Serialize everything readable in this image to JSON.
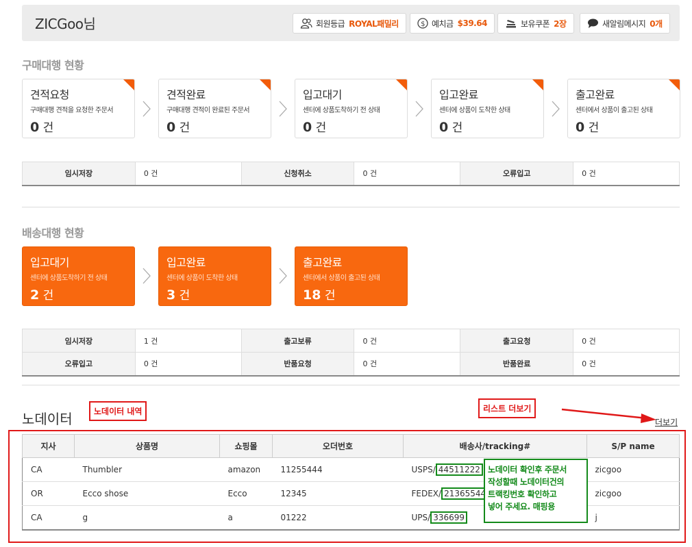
{
  "header": {
    "username": "ZICGoo님",
    "grade_label": "회원등급",
    "grade_value": "ROYAL패밀리",
    "deposit_label": "예치금",
    "deposit_value": "$39.64",
    "coupon_label": "보유쿠폰",
    "coupon_value": "2장",
    "message_label": "새알림메시지",
    "message_value": "0개"
  },
  "purchase": {
    "title": "구매대행 현황",
    "cards": [
      {
        "title": "견적요청",
        "desc": "구매대행 견적을 요청한 주문서",
        "count": "0",
        "unit": "건"
      },
      {
        "title": "견적완료",
        "desc": "구매대행 견적이 완료된 주문서",
        "count": "0",
        "unit": "건"
      },
      {
        "title": "입고대기",
        "desc": "센터에 상품도착하기 전 상태",
        "count": "0",
        "unit": "건"
      },
      {
        "title": "입고완료",
        "desc": "센터에 상품이 도착한 상태",
        "count": "0",
        "unit": "건"
      },
      {
        "title": "출고완료",
        "desc": "센터에서 상품이 출고된 상태",
        "count": "0",
        "unit": "건"
      }
    ],
    "stats": [
      {
        "label": "임시저장",
        "value": "0 건"
      },
      {
        "label": "신청취소",
        "value": "0 건"
      },
      {
        "label": "오류입고",
        "value": "0 건"
      }
    ]
  },
  "shipping": {
    "title": "배송대행 현황",
    "cards": [
      {
        "title": "입고대기",
        "desc": "센터에 상품도착하기 전 상태",
        "count": "2",
        "unit": "건"
      },
      {
        "title": "입고완료",
        "desc": "센터에 상품이 도착한 상태",
        "count": "3",
        "unit": "건"
      },
      {
        "title": "출고완료",
        "desc": "센터에서 상품이 출고된 상태",
        "count": "18",
        "unit": "건"
      }
    ],
    "stats": [
      {
        "label": "임시저장",
        "value": "1 건"
      },
      {
        "label": "출고보류",
        "value": "0 건"
      },
      {
        "label": "출고요청",
        "value": "0 건"
      },
      {
        "label": "오류입고",
        "value": "0 건"
      },
      {
        "label": "반품요청",
        "value": "0 건"
      },
      {
        "label": "반품완료",
        "value": "0 건"
      }
    ]
  },
  "nodata": {
    "title": "노데이터",
    "annotation_title": "노데이터 내역",
    "annotation_more": "리스트 더보기",
    "more_link": "더보기",
    "columns": [
      "지사",
      "상품명",
      "쇼핑몰",
      "오더번호",
      "배송사/tracking#",
      "S/P name"
    ],
    "rows": [
      {
        "branch": "CA",
        "product": "Thumbler",
        "mall": "amazon",
        "order": "11255444",
        "carrier": "USPS/",
        "tracking": "44511222",
        "sp": "zicgoo"
      },
      {
        "branch": "OR",
        "product": "Ecco shose",
        "mall": "Ecco",
        "order": "12345",
        "carrier": "FEDEX/",
        "tracking": "213655444",
        "sp": "zicgoo"
      },
      {
        "branch": "CA",
        "product": "g",
        "mall": "a",
        "order": "01222",
        "carrier": "UPS/",
        "tracking": "336699",
        "sp": "j"
      }
    ],
    "note_lines": [
      "노데이터 확인후 주문서",
      "작성할때 노데이터건의",
      "트랙킹번호 확인하고",
      "넣어 주세요. 매핑용"
    ]
  },
  "colors": {
    "accent": "#f8680f",
    "annotation_red": "#e01818",
    "annotation_green": "#138a1a"
  }
}
